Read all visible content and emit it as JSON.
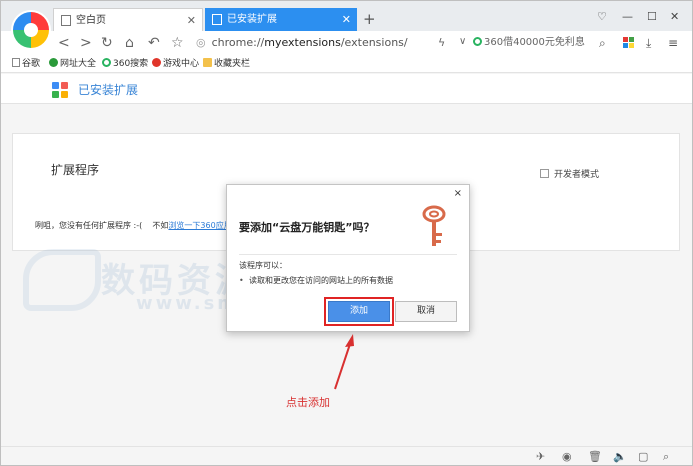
{
  "tabs": [
    {
      "label": "空白页",
      "active": false
    },
    {
      "label": "已安装扩展",
      "active": true
    }
  ],
  "address": {
    "prefix": "chrome://",
    "host": "myextensions",
    "path": "/extensions/"
  },
  "search": {
    "text": "360借40000元免利息"
  },
  "bookmarks": [
    {
      "label": "谷歌",
      "icon": "page-icon"
    },
    {
      "label": "网址大全",
      "icon": "globe-icon",
      "color": "#2a9a3a"
    },
    {
      "label": "360搜索",
      "icon": "search-360-icon",
      "color": "#29b360"
    },
    {
      "label": "游戏中心",
      "icon": "game-icon",
      "color": "#e0352a"
    },
    {
      "label": "收藏夹栏",
      "icon": "folder-icon",
      "color": "#f3c14b"
    }
  ],
  "page": {
    "title": "已安装扩展"
  },
  "extensions": {
    "heading": "扩展程序",
    "dev_mode_label": "开发者模式",
    "empty_msg": "咧咀，您没有任何扩展程序 :-(",
    "hint_prefix": "不如",
    "hint_link": "浏览一下360应用"
  },
  "dialog": {
    "close": "×",
    "title": "要添加“云盘万能钥匙”吗？",
    "can_label": "该程序可以：",
    "permission": "读取和更改您在访问的网站上的所有数据",
    "add_label": "添加",
    "cancel_label": "取消"
  },
  "watermark": {
    "cn": "数码资源网",
    "en": "www.smzy.com"
  },
  "annotation": {
    "text": "点击添加",
    "color": "#d83030"
  },
  "colors": {
    "tab_active": "#2c8ff0",
    "link": "#2c7bd6",
    "add_button": "#4a90e8",
    "highlight": "#e02424",
    "key": "#d86a4a"
  }
}
